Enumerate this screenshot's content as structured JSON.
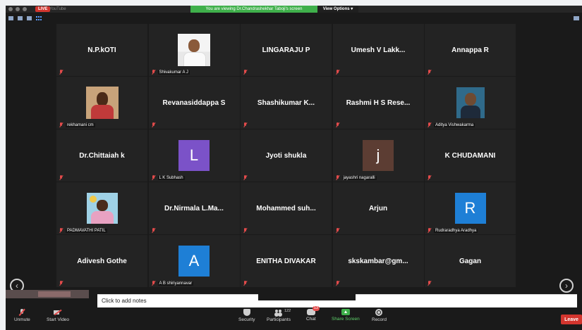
{
  "window": {
    "live_label": "LIVE",
    "youtube_label": "YouTube",
    "banner": "You are viewing Dr.Chandrashekhar Taboji's screen",
    "view_options": "View Options"
  },
  "tiles": [
    {
      "name": "N.P.kOTI",
      "type": "text"
    },
    {
      "name": "Shivakumar A J",
      "type": "photo",
      "photo": "shiv"
    },
    {
      "name": "LINGARAJU P",
      "type": "text"
    },
    {
      "name": "Umesh  V  Lakk...",
      "type": "text"
    },
    {
      "name": "Annappa R",
      "type": "text"
    },
    {
      "name": "rekhamani cm",
      "type": "photo",
      "photo": "rekha"
    },
    {
      "name": "Revanasiddappa S",
      "type": "text"
    },
    {
      "name": "Shashikumar  K...",
      "type": "text"
    },
    {
      "name": "Rashmi  H  S  Rese...",
      "type": "text"
    },
    {
      "name": "Aditya Vishwakarma",
      "type": "photo",
      "photo": "aditya"
    },
    {
      "name": "Dr.Chittaiah k",
      "type": "text"
    },
    {
      "name": "L K Subhash",
      "type": "avatar",
      "letter": "L",
      "color": "#7b52c8"
    },
    {
      "name": "Jyoti shukla",
      "type": "text"
    },
    {
      "name": "jayashri nagaralli",
      "type": "avatar",
      "letter": "j",
      "color": "#5c3d33"
    },
    {
      "name": "K CHUDAMANI",
      "type": "text"
    },
    {
      "name": "PADMAVATHI PATIL",
      "type": "photo",
      "photo": "padma"
    },
    {
      "name": "Dr.Nirmala  L.Ma...",
      "type": "text"
    },
    {
      "name": "Mohammed  suh...",
      "type": "text"
    },
    {
      "name": "Arjun",
      "type": "text"
    },
    {
      "name": "Rudraradhya Aradhya",
      "type": "avatar",
      "letter": "R",
      "color": "#1e7fd6"
    },
    {
      "name": "Adivesh Gothe",
      "type": "text"
    },
    {
      "name": "A B shiriyannavar",
      "type": "avatar",
      "letter": "A",
      "color": "#1e7fd6"
    },
    {
      "name": "ENITHA DIVAKAR",
      "type": "text"
    },
    {
      "name": "skskambar@gm...",
      "type": "text"
    },
    {
      "name": "Gagan",
      "type": "text"
    }
  ],
  "nav": {
    "prev": "‹",
    "next": "›"
  },
  "notes": {
    "placeholder": "Click to add notes"
  },
  "toolbar": {
    "unmute": "Unmute",
    "start_video": "Start Video",
    "security": "Security",
    "participants": "Participants",
    "participants_count": "122",
    "chat": "Chat",
    "chat_badge": "13",
    "share_screen": "Share Screen",
    "record": "Record",
    "leave": "Leave"
  }
}
